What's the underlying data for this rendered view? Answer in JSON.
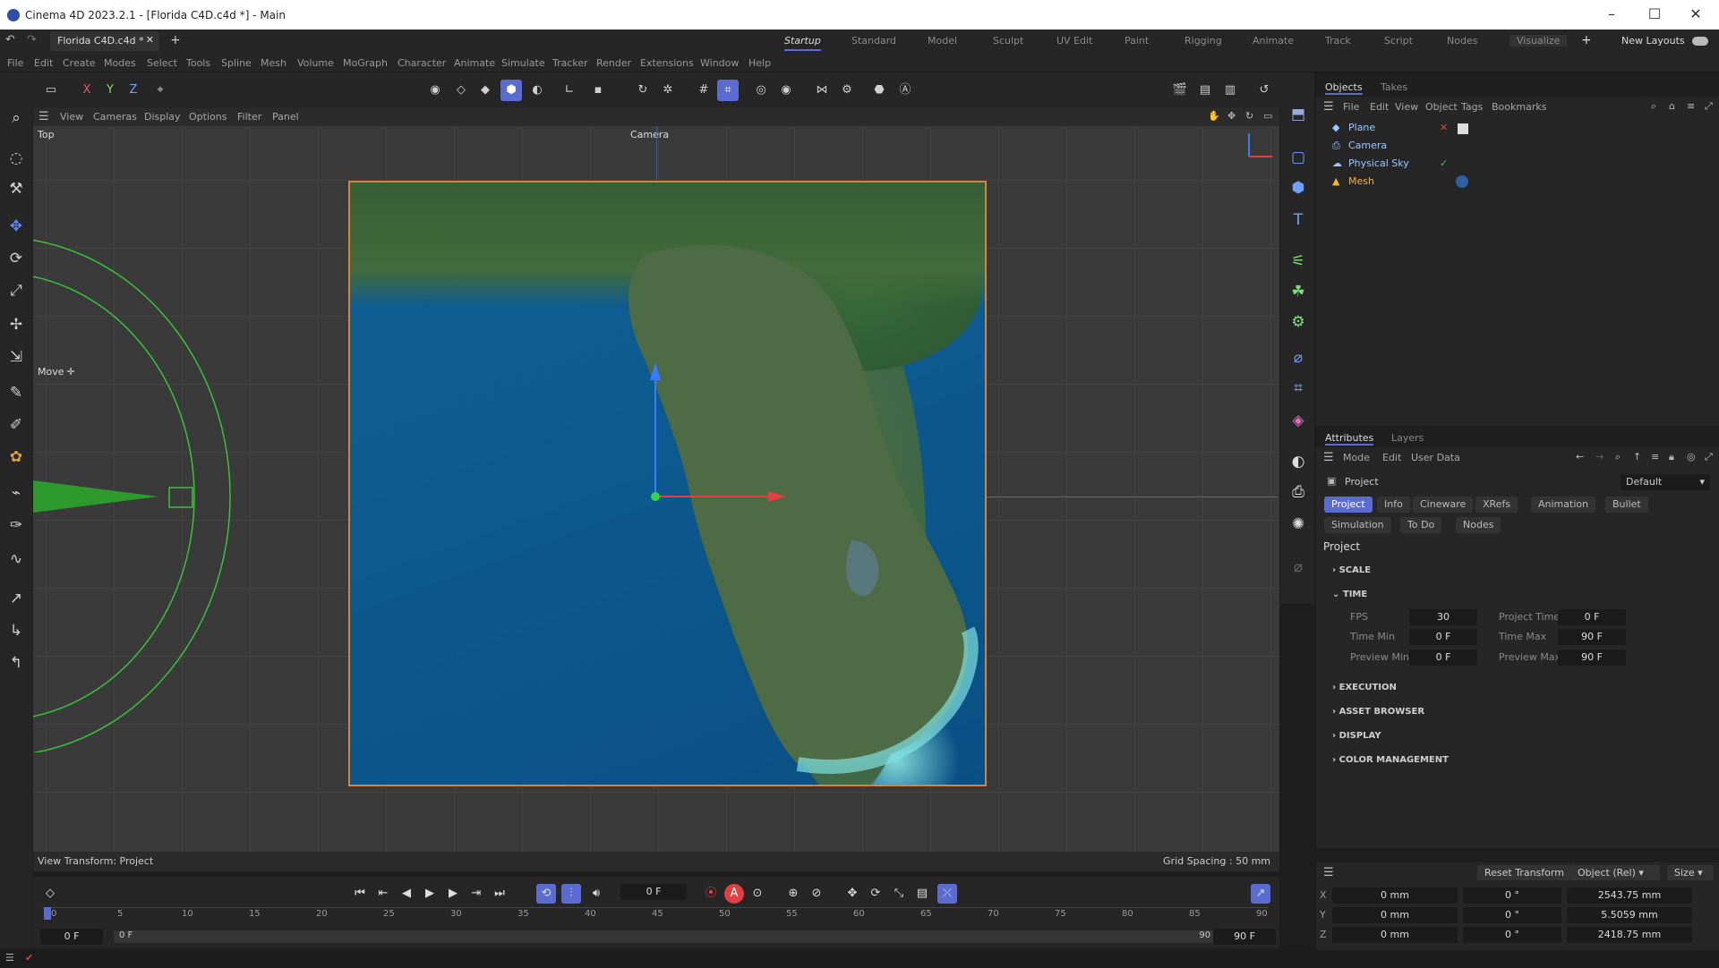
{
  "window": {
    "title": "Cinema 4D 2023.2.1 - [Florida C4D.c4d *] - Main"
  },
  "tabs": {
    "doc": "Florida C4D.c4d *",
    "add": "+"
  },
  "layouts": [
    "Startup",
    "Standard",
    "Model",
    "Sculpt",
    "UV Edit",
    "Paint",
    "Rigging",
    "Animate",
    "Track",
    "Script",
    "Nodes",
    "Visualize"
  ],
  "layouts_extra": {
    "plus": "+",
    "new_layouts": "New Layouts"
  },
  "menu": [
    "File",
    "Edit",
    "Create",
    "Modes",
    "Select",
    "Tools",
    "Spline",
    "Mesh",
    "Volume",
    "MoGraph",
    "Character",
    "Animate",
    "Simulate",
    "Tracker",
    "Render",
    "Extensions",
    "Window",
    "Help"
  ],
  "toolbar": {
    "x": "X",
    "y": "Y",
    "z": "Z"
  },
  "viewport": {
    "menu": [
      "View",
      "Cameras",
      "Display",
      "Options",
      "Filter",
      "Panel"
    ],
    "label": "Top",
    "camera": "Camera",
    "move_label": "Move",
    "view_transform": "View Transform: Project",
    "grid_spacing": "Grid Spacing : 50 mm"
  },
  "objects_panel": {
    "tabs": [
      "Objects",
      "Takes"
    ],
    "menu": [
      "File",
      "Edit",
      "View",
      "Object",
      "Tags",
      "Bookmarks"
    ],
    "items": [
      "Plane",
      "Camera",
      "Physical Sky",
      "Mesh"
    ]
  },
  "attributes_panel": {
    "tabs": [
      "Attributes",
      "Layers"
    ],
    "menu": [
      "Mode",
      "Edit",
      "User Data"
    ],
    "title": "Project",
    "preset": "Default",
    "sub_tabs": [
      "Project",
      "Info",
      "Cineware",
      "XRefs",
      "Animation",
      "Bullet",
      "Simulation",
      "To Do",
      "Nodes"
    ],
    "section_title": "Project",
    "sections": [
      "SCALE",
      "TIME",
      "EXECUTION",
      "ASSET BROWSER",
      "DISPLAY",
      "COLOR MANAGEMENT"
    ],
    "time": {
      "fps_label": "FPS",
      "fps": "30",
      "project_time_label": "Project Time",
      "project_time": "0 F",
      "time_min_label": "Time Min",
      "time_min": "0 F",
      "time_max_label": "Time Max",
      "time_max": "90 F",
      "preview_min_label": "Preview Min",
      "preview_min": "0 F",
      "preview_max_label": "Preview Max",
      "preview_max": "90 F"
    }
  },
  "coordinates": {
    "reset": "Reset Transform",
    "mode": "Object (Rel)",
    "size": "Size",
    "rows": [
      {
        "axis": "X",
        "pos": "0 mm",
        "rot": "0 °",
        "size": "2543.75 mm"
      },
      {
        "axis": "Y",
        "pos": "0 mm",
        "rot": "0 °",
        "size": "5.5059 mm"
      },
      {
        "axis": "Z",
        "pos": "0 mm",
        "rot": "0 °",
        "size": "2418.75 mm"
      }
    ]
  },
  "timeline": {
    "current_frame": "0 F",
    "ticks": [
      "0",
      "5",
      "10",
      "15",
      "20",
      "25",
      "30",
      "35",
      "40",
      "45",
      "50",
      "55",
      "60",
      "65",
      "70",
      "75",
      "80",
      "85",
      "90"
    ],
    "start": "0 F",
    "range_start": "0 F",
    "range_end": "90 F",
    "end": "90 F"
  },
  "colors": {
    "accent": "#5b6cd1",
    "selection": "#d9823a"
  }
}
